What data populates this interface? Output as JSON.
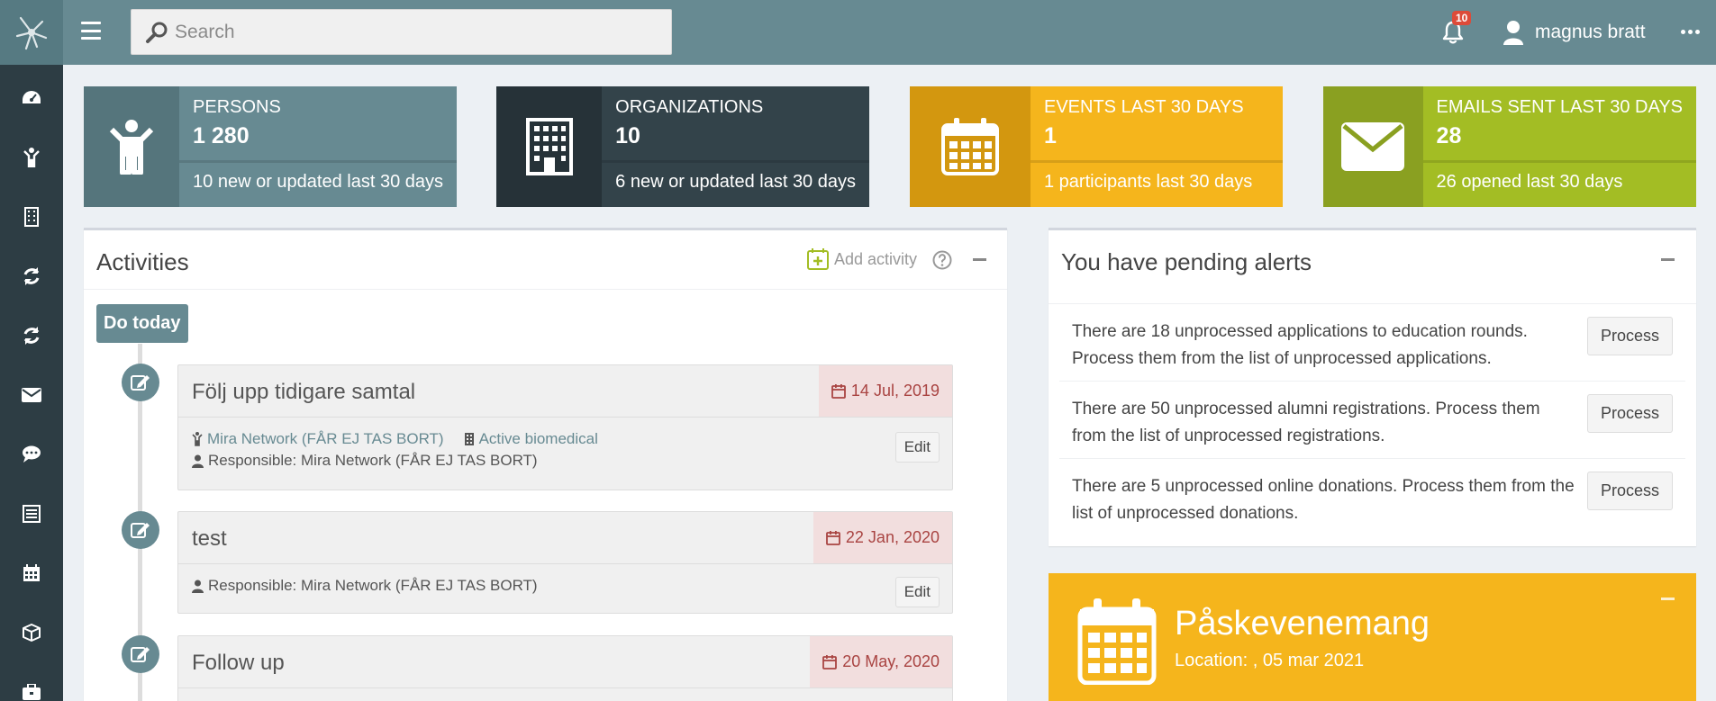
{
  "topbar": {
    "search_placeholder": "Search",
    "notifications_count": "10",
    "user_name": "magnus bratt"
  },
  "sidebar": {
    "icons": [
      "dashboard-icon",
      "person-icon",
      "building-icon",
      "sync-icon",
      "sync-icon",
      "envelope-icon",
      "comment-icon",
      "list-icon",
      "calendar-icon",
      "cube-icon",
      "briefcase-icon"
    ]
  },
  "stats": [
    {
      "label": "PERSONS",
      "value": "1 280",
      "footer": "10 new or updated last 30 days",
      "color": "#678a92"
    },
    {
      "label": "ORGANIZATIONS",
      "value": "10",
      "footer": "6 new or updated last 30 days",
      "color": "#33434a"
    },
    {
      "label": "EVENTS LAST 30 DAYS",
      "value": "1",
      "footer": "1 participants last 30 days",
      "color": "#f5b51c"
    },
    {
      "label": "EMAILS SENT LAST 30 DAYS",
      "value": "28",
      "footer": "26 opened last 30 days",
      "color": "#a3bd24"
    }
  ],
  "activities": {
    "title": "Activities",
    "add_label": "Add activity",
    "do_today": "Do today",
    "items": [
      {
        "title": "Följ upp tidigare samtal",
        "date": "14 Jul, 2019",
        "person": "Mira Network (FÅR EJ TAS BORT)",
        "organization": "Active biomedical",
        "responsible": "Responsible: Mira Network (FÅR EJ TAS BORT)",
        "edit": "Edit"
      },
      {
        "title": "test",
        "date": "22 Jan, 2020",
        "responsible": "Responsible: Mira Network (FÅR EJ TAS BORT)",
        "edit": "Edit"
      },
      {
        "title": "Follow up",
        "date": "20 May, 2020"
      }
    ]
  },
  "alerts": {
    "title": "You have pending alerts",
    "items": [
      {
        "text": "There are 18 unprocessed applications to education rounds. Process them from the list of unprocessed applications.",
        "button": "Process"
      },
      {
        "text": "There are 50 unprocessed alumni registrations. Process them from the list of unprocessed registrations.",
        "button": "Process"
      },
      {
        "text": "There are 5 unprocessed online donations. Process them from the list of unprocessed donations.",
        "button": "Process"
      }
    ]
  },
  "event": {
    "name": "Påskevenemang",
    "location": "Location: , 05 mar 2021"
  }
}
